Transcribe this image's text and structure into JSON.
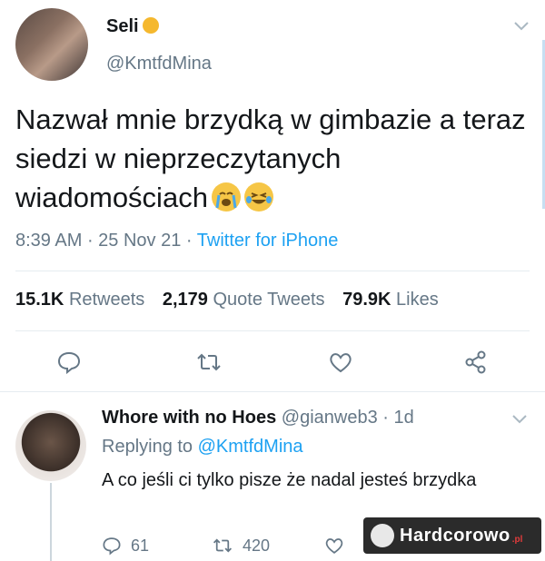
{
  "tweet": {
    "author": {
      "display_name": "Seli",
      "handle": "@KmtfdMina"
    },
    "text": "Nazwał mnie brzydką w gimbazie a teraz siedzi w nieprzeczytanych wiadomościach",
    "time": "8:39 AM",
    "date": "25 Nov 21",
    "source": "Twitter for iPhone",
    "stats": {
      "retweets_count": "15.1K",
      "retweets_label": "Retweets",
      "quotes_count": "2,179",
      "quotes_label": "Quote Tweets",
      "likes_count": "79.9K",
      "likes_label": "Likes"
    },
    "actions": [
      "reply",
      "retweet",
      "like",
      "share"
    ]
  },
  "reply": {
    "display_name": "Whore with no Hoes",
    "handle": "@gianweb3",
    "age": "1d",
    "replying_label": "Replying to",
    "replying_to": "@KmtfdMina",
    "text": "A co jeśli ci tylko pisze że nadal jesteś brzydka",
    "reply_count": "61",
    "retweet_count": "420"
  },
  "watermark": {
    "text": "Hardcorowo",
    "suffix": ".pl"
  },
  "colors": {
    "link": "#1da1f2",
    "muted": "#657786",
    "text": "#14171a",
    "divider": "#e6ecf0"
  },
  "icons": [
    "chevron-down-icon",
    "reply-icon",
    "retweet-icon",
    "heart-icon",
    "share-icon",
    "skull-icon",
    "crying-emoji",
    "laughing-emoji",
    "honey-pot-emoji"
  ]
}
